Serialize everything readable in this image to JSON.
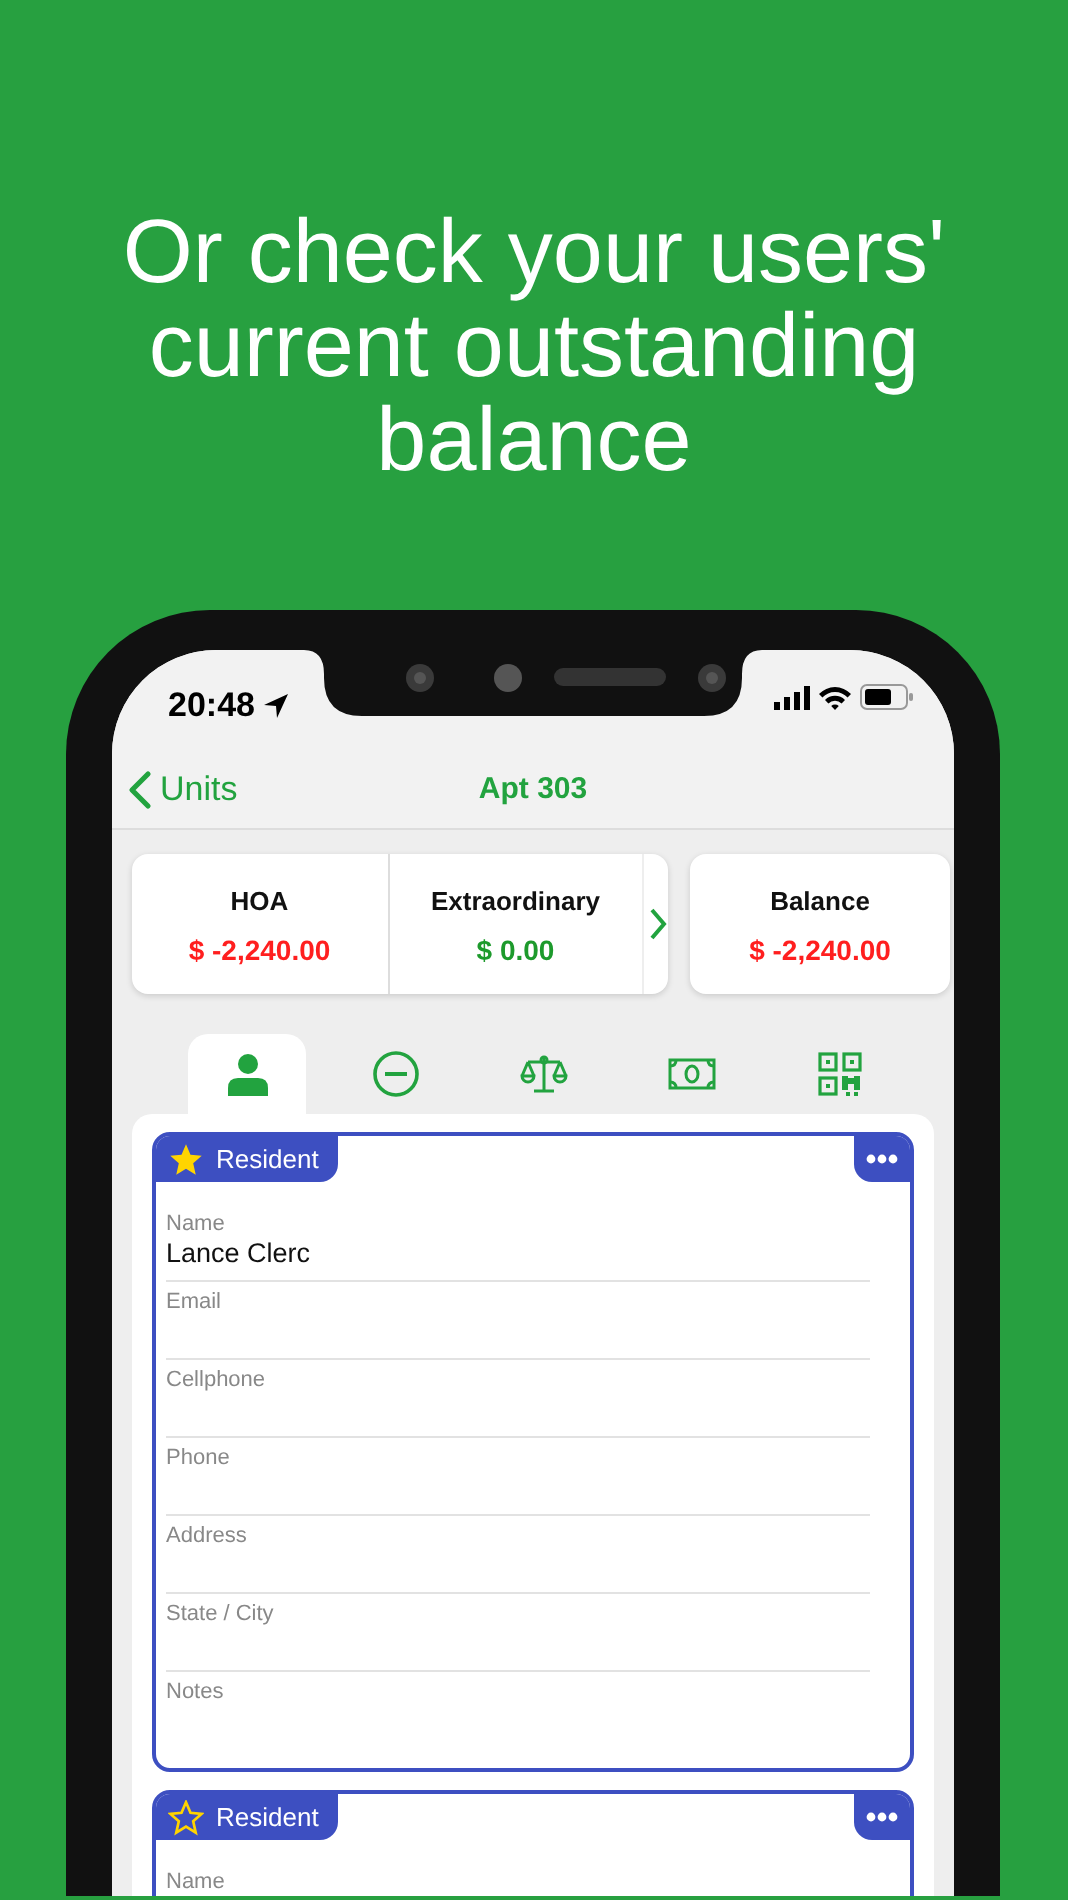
{
  "headline": "Or check your users' current outstanding balance",
  "status_bar": {
    "time": "20:48"
  },
  "nav": {
    "back": "Units",
    "title": "Apt 303"
  },
  "summary": {
    "items": [
      {
        "label": "HOA",
        "amount": "$ -2,240.00",
        "color": "#ff1f1f"
      },
      {
        "label": "Extraordinary",
        "amount": "$ 0.00",
        "color": "#1d9a2c"
      }
    ]
  },
  "balance": {
    "label": "Balance",
    "amount": "$ -2,240.00",
    "color": "#ff1f1f"
  },
  "tabs": [
    {
      "kind": "person",
      "selected": true
    },
    {
      "kind": "minus",
      "selected": false
    },
    {
      "kind": "scale",
      "selected": false
    },
    {
      "kind": "cash",
      "selected": false
    },
    {
      "kind": "qr",
      "selected": false
    }
  ],
  "residents": [
    {
      "label": "Resident",
      "primary": true,
      "fields": [
        {
          "label": "Name",
          "value": "Lance Clerc"
        },
        {
          "label": "Email"
        },
        {
          "label": "Cellphone"
        },
        {
          "label": "Phone"
        },
        {
          "label": "Address"
        },
        {
          "label": "State / City"
        },
        {
          "label": "Notes"
        }
      ]
    },
    {
      "label": "Resident",
      "primary": false,
      "fields": [
        {
          "label": "Name"
        }
      ]
    }
  ]
}
